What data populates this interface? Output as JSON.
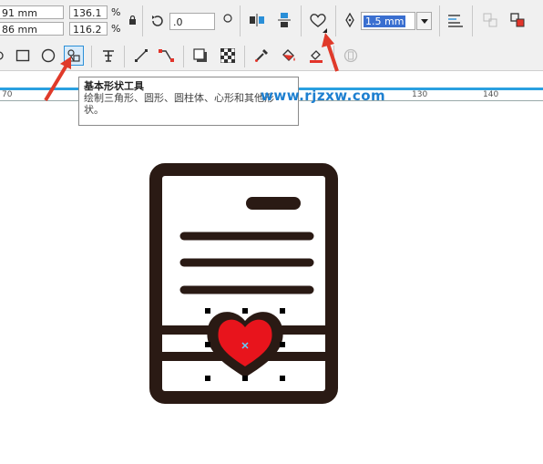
{
  "toolbar_top": {
    "pos_x": "91 mm",
    "pos_y": "86 mm",
    "scale_w": "136.1",
    "scale_h": "116.2",
    "percent": "%",
    "rotation": ".0",
    "outline_width": "1.5 mm"
  },
  "ruler": {
    "ticks": [
      "70",
      "130",
      "140"
    ]
  },
  "tooltip": {
    "title": "基本形状工具",
    "desc": "绘制三角形、圆形、圆柱体、心形和其他形状。"
  },
  "watermark": "www.rjzxw.com",
  "colors": {
    "accent": "#2aa0e0",
    "heart": "#e8141c",
    "outline": "#2a1a14",
    "arrow": "#e03a2a"
  },
  "icons": [
    "lock-icon",
    "rotate-icon",
    "mirror-h-icon",
    "mirror-v-icon",
    "heart-shape-icon",
    "pen-nib-icon",
    "dropdown-icon",
    "align-icon",
    "rectangle-tool-icon",
    "ellipse-tool-icon",
    "basic-shapes-tool-icon",
    "text-tool-icon",
    "line-tool-icon",
    "connector-tool-icon",
    "shadow-tool-icon",
    "transparency-tool-icon",
    "eyedropper-tool-icon",
    "fill-tool-icon",
    "outline-fill-icon"
  ]
}
